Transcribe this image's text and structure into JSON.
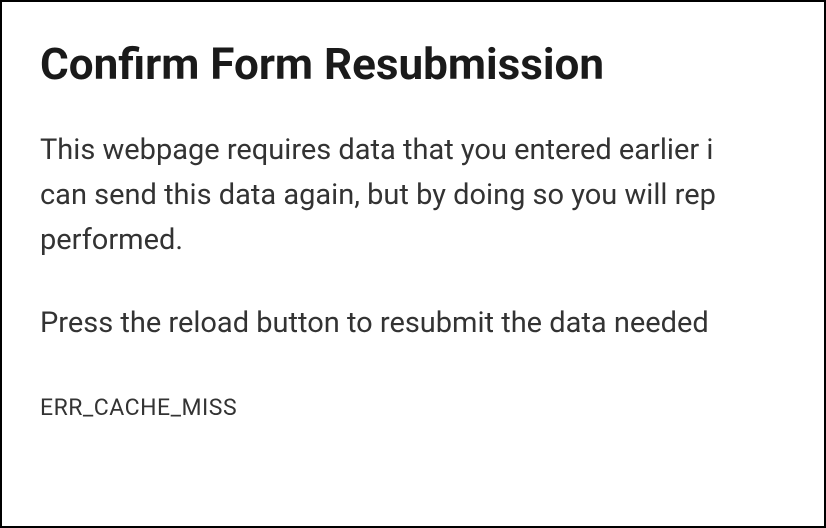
{
  "error": {
    "title": "Confirm Form Resubmission",
    "description_line1": "This webpage requires data that you entered earlier i",
    "description_line2": "can send this data again, but by doing so you will rep",
    "description_line3": "performed.",
    "instruction": "Press the reload button to resubmit the data needed",
    "code": "ERR_CACHE_MISS"
  }
}
